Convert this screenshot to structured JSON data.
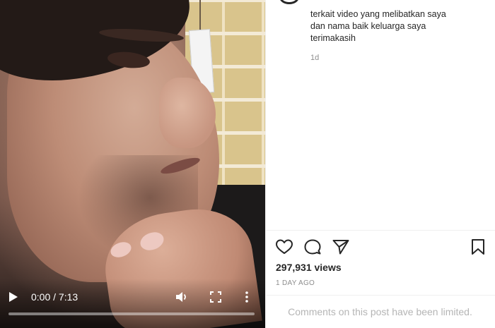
{
  "video": {
    "current_time": "0:00",
    "duration": "7:13",
    "time_display": "0:00 / 7:13",
    "progress": 0,
    "play_icon": "play-icon",
    "volume_icon": "volume-icon",
    "fullscreen_icon": "fullscreen-icon",
    "more_icon": "more-vertical-icon"
  },
  "post": {
    "caption": "terkait video yang melibatkan saya\ndan nama baik keluarga saya\nterimakasih",
    "caption_time": "1d",
    "views": "297,931 views",
    "posted": "1 DAY AGO",
    "comments_notice": "Comments on this post have been limited.",
    "actions": [
      "heart-icon",
      "comment-icon",
      "share-icon",
      "bookmark-icon"
    ]
  },
  "colors": {
    "text": "#262626",
    "muted": "#8e8e8e",
    "divider": "#efefef"
  }
}
